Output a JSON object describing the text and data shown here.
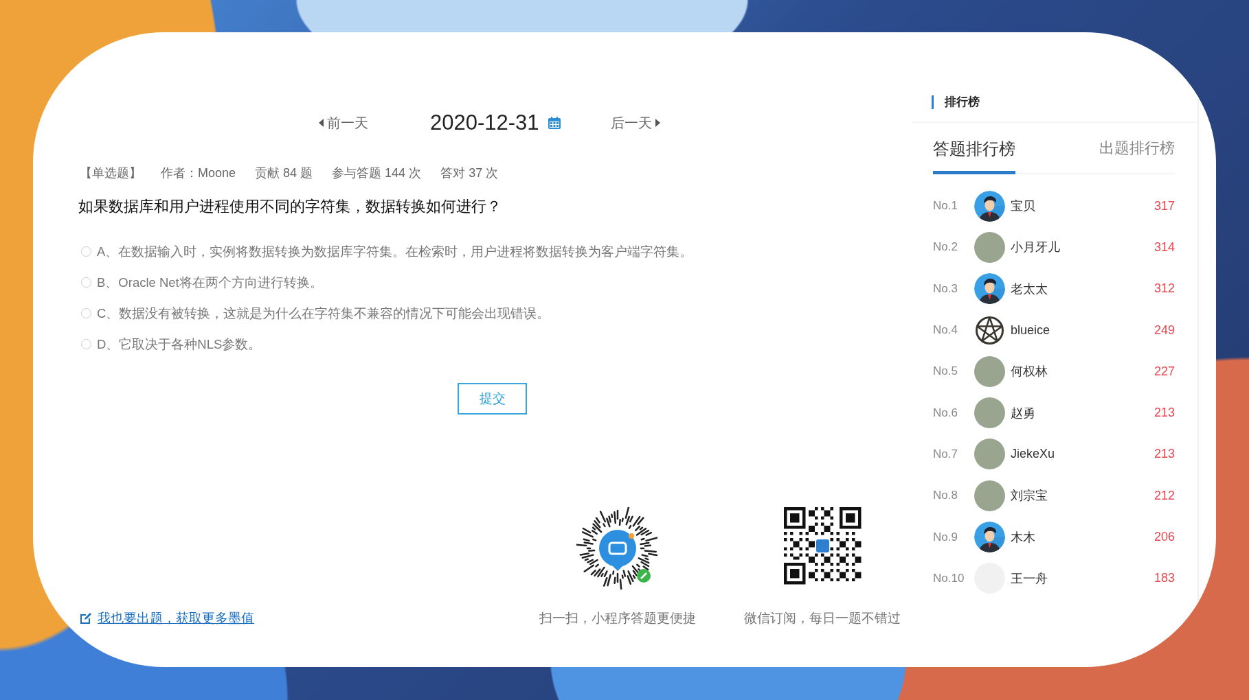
{
  "nav": {
    "prev": "前一天",
    "date": "2020-12-31",
    "next": "后一天"
  },
  "question": {
    "meta": [
      "【单选题】",
      "作者：Moone",
      "贡献 84 题",
      "参与答题 144 次",
      "答对 37 次"
    ],
    "title": "如果数据库和用户进程使用不同的字符集，数据转换如何进行？",
    "options": [
      {
        "text": "A、在数据输入时，实例将数据转换为数据库字符集。在检索时，用户进程将数据转换为客户端字符集。",
        "selected": false
      },
      {
        "text": "B、Oracle Net将在两个方向进行转换。",
        "selected": false
      },
      {
        "text": "C、数据没有被转换，这就是为什么在字符集不兼容的情况下可能会出现错误。",
        "selected": false
      },
      {
        "text": "D、它取决于各种NLS参数。",
        "selected": false
      }
    ],
    "submit": "提交"
  },
  "footer": {
    "link": "我也要出题，获取更多墨值",
    "codes": [
      {
        "kind": "miniprogram",
        "caption": "扫一扫，小程序答题更便捷"
      },
      {
        "kind": "qr",
        "caption": "微信订阅，每日一题不错过"
      }
    ]
  },
  "leaderboard": {
    "title": "排行榜",
    "tabs": [
      {
        "label": "答题排行榜",
        "selected": true
      },
      {
        "label": "出题排行榜",
        "selected": false
      }
    ],
    "rows": [
      {
        "rank": "No.1",
        "kind": "default",
        "name": "宝贝",
        "score": "317"
      },
      {
        "rank": "No.2",
        "kind": "photo",
        "name": "小月牙儿",
        "score": "314"
      },
      {
        "rank": "No.3",
        "kind": "default",
        "name": "老太太",
        "score": "312"
      },
      {
        "rank": "No.4",
        "kind": "emblem",
        "name": "blueice",
        "score": "249"
      },
      {
        "rank": "No.5",
        "kind": "photo",
        "name": "何权林",
        "score": "227"
      },
      {
        "rank": "No.6",
        "kind": "photo",
        "name": "赵勇",
        "score": "213"
      },
      {
        "rank": "No.7",
        "kind": "photo",
        "name": "JiekeXu",
        "score": "213"
      },
      {
        "rank": "No.8",
        "kind": "photo",
        "name": "刘宗宝",
        "score": "212"
      },
      {
        "rank": "No.9",
        "kind": "default",
        "name": "木木",
        "score": "206"
      },
      {
        "rank": "No.10",
        "kind": "sketch",
        "name": "王一舟",
        "score": "183"
      }
    ]
  }
}
